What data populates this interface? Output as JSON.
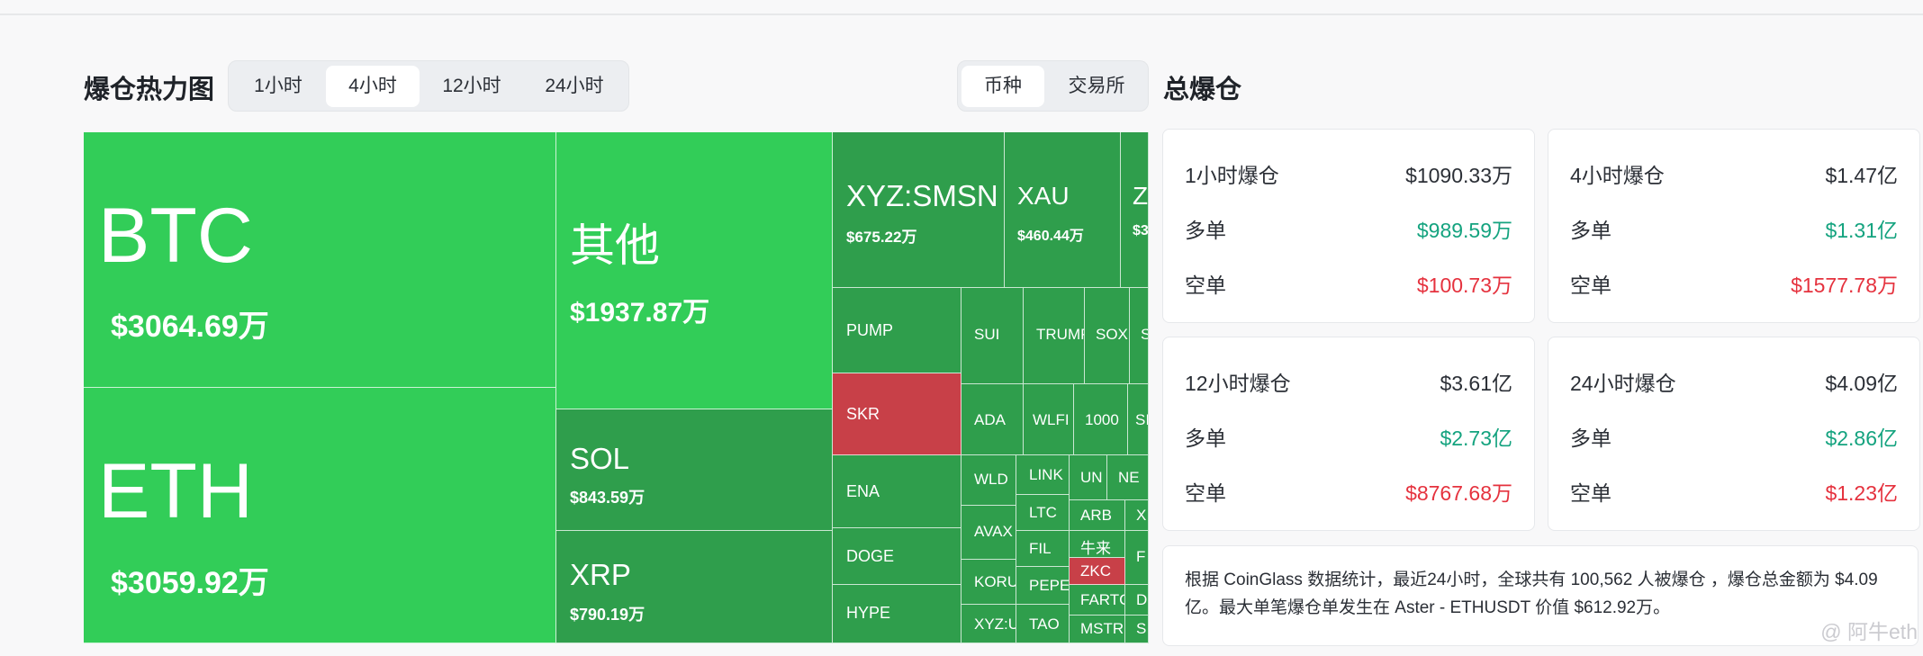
{
  "heatmap": {
    "title": "爆仓热力图",
    "time_tabs": [
      "1小时",
      "4小时",
      "12小时",
      "24小时"
    ],
    "active_time_tab": "4小时",
    "group_tabs": [
      "币种",
      "交易所"
    ],
    "active_group_tab": "币种",
    "tiles": [
      {
        "name": "BTC",
        "value": "$3064.69万"
      },
      {
        "name": "ETH",
        "value": "$3059.92万"
      },
      {
        "name": "其他",
        "value": "$1937.87万"
      },
      {
        "name": "SOL",
        "value": "$843.59万"
      },
      {
        "name": "XRP",
        "value": "$790.19万"
      },
      {
        "name": "XYZ:SMSN",
        "value": "$675.22万"
      },
      {
        "name": "XAU",
        "value": "$460.44万"
      },
      {
        "name": "Z",
        "value": "$3"
      },
      {
        "name": "PUMP",
        "value": ""
      },
      {
        "name": "SUI",
        "value": ""
      },
      {
        "name": "TRUMP",
        "value": ""
      },
      {
        "name": "SOX",
        "value": ""
      },
      {
        "name": "S",
        "value": ""
      },
      {
        "name": "SKR",
        "value": ""
      },
      {
        "name": "ADA",
        "value": ""
      },
      {
        "name": "WLFI",
        "value": ""
      },
      {
        "name": "1000",
        "value": ""
      },
      {
        "name": "SI",
        "value": ""
      },
      {
        "name": "ENA",
        "value": ""
      },
      {
        "name": "WLD",
        "value": ""
      },
      {
        "name": "LINK",
        "value": ""
      },
      {
        "name": "UN",
        "value": ""
      },
      {
        "name": "NE",
        "value": ""
      },
      {
        "name": "AVAX",
        "value": ""
      },
      {
        "name": "LTC",
        "value": ""
      },
      {
        "name": "ARB",
        "value": ""
      },
      {
        "name": "X",
        "value": ""
      },
      {
        "name": "DOGE",
        "value": ""
      },
      {
        "name": "FIL",
        "value": ""
      },
      {
        "name": "牛来",
        "value": ""
      },
      {
        "name": "KORU",
        "value": ""
      },
      {
        "name": "ZKC",
        "value": ""
      },
      {
        "name": "F",
        "value": ""
      },
      {
        "name": "PEPE",
        "value": ""
      },
      {
        "name": "HYPE",
        "value": ""
      },
      {
        "name": "FARTC",
        "value": ""
      },
      {
        "name": "D",
        "value": ""
      },
      {
        "name": "XYZ:U",
        "value": ""
      },
      {
        "name": "TAO",
        "value": ""
      },
      {
        "name": "MSTR",
        "value": ""
      },
      {
        "name": "S",
        "value": ""
      }
    ]
  },
  "summary": {
    "title": "总爆仓",
    "cards": [
      {
        "title": "1小时爆仓",
        "total": "$1090.33万",
        "long_label": "多单",
        "long": "$989.59万",
        "short_label": "空单",
        "short": "$100.73万"
      },
      {
        "title": "4小时爆仓",
        "total": "$1.47亿",
        "long_label": "多单",
        "long": "$1.31亿",
        "short_label": "空单",
        "short": "$1577.78万"
      },
      {
        "title": "12小时爆仓",
        "total": "$3.61亿",
        "long_label": "多单",
        "long": "$2.73亿",
        "short_label": "空单",
        "short": "$8767.68万"
      },
      {
        "title": "24小时爆仓",
        "total": "$4.09亿",
        "long_label": "多单",
        "long": "$2.86亿",
        "short_label": "空单",
        "short": "$1.23亿"
      }
    ],
    "note": "根据 CoinGlass 数据统计，最近24小时，全球共有 100,562 人被爆仓 ，爆仓总金额为 $4.09 亿。最大单笔爆仓单发生在 Aster - ETHUSDT 价值 $612.92万。"
  },
  "watermark": "@ 阿牛eth",
  "colors": {
    "bright_green": "#32cd58",
    "dark_green": "#2f9e4c",
    "red": "#c84048",
    "long": "#14a37f",
    "short": "#e5323e"
  }
}
